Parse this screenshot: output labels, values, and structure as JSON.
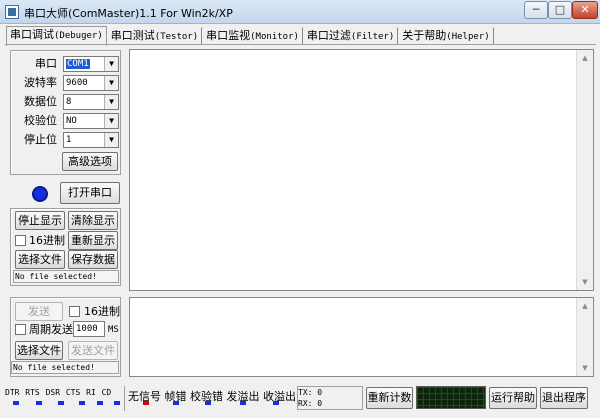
{
  "window": {
    "title": "串口大师(ComMaster)1.1 For Win2k/XP",
    "minimize": "─",
    "maximize": "□",
    "close": "✕"
  },
  "tabs": [
    {
      "cn": "串口调试",
      "en": "(Debuger)"
    },
    {
      "cn": "串口测试",
      "en": "(Testor)"
    },
    {
      "cn": "串口监视",
      "en": "(Monitor)"
    },
    {
      "cn": "串口过滤",
      "en": "(Filter)"
    },
    {
      "cn": "关于帮助",
      "en": "(Helper)"
    }
  ],
  "settings": {
    "port": {
      "label": "串口",
      "value": "COM1"
    },
    "baud": {
      "label": "波特率",
      "value": "9600"
    },
    "databits": {
      "label": "数据位",
      "value": "8"
    },
    "parity": {
      "label": "校验位",
      "value": "NO"
    },
    "stopbits": {
      "label": "停止位",
      "value": "1"
    },
    "advanced_label": "高级选项"
  },
  "open_port_label": "打开串口",
  "receive": {
    "stop_display": "停止显示",
    "clear_display": "清除显示",
    "hex_label": "16进制",
    "redisplay": "重新显示",
    "choose_file": "选择文件",
    "save_data": "保存数据",
    "file_status": "No file selected!"
  },
  "send": {
    "send_label": "发送",
    "hex_label": "16进制",
    "periodic_label": "周期发送",
    "period_value": "1000",
    "period_unit": "MS",
    "choose_file": "选择文件",
    "send_file": "发送文件",
    "file_status": "No file selected!"
  },
  "statusbar": {
    "signals": [
      "DTR",
      "RTS",
      "DSR",
      "CTS",
      "RI",
      "CD"
    ],
    "errors": [
      "无信号",
      "帧错",
      "校验错",
      "发溢出",
      "收溢出"
    ],
    "tx": "TX: 0",
    "rx": "RX: 0",
    "reset_counter": "重新计数",
    "help": "运行帮助",
    "exit": "退出程序"
  },
  "colors": {
    "led": "#1530e0",
    "signal_on": "#1530e0",
    "signal_alert": "#e00000",
    "scope_bg": "#0a250a"
  }
}
